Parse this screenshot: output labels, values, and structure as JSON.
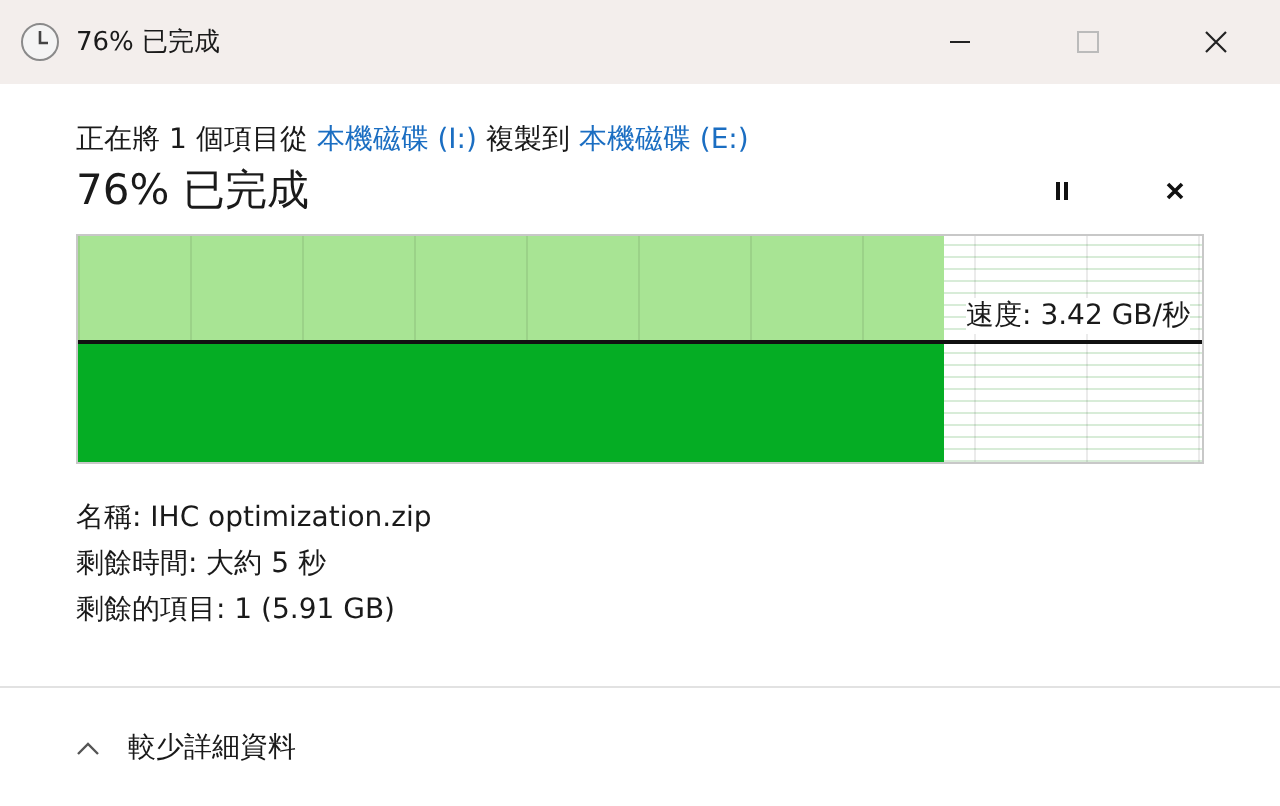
{
  "window": {
    "title": "76% 已完成"
  },
  "copy_line": [
    {
      "kind": "text",
      "text": "正在將 1 個項目從 "
    },
    {
      "kind": "link",
      "text": "本機磁碟 (I:)"
    },
    {
      "kind": "text",
      "text": " 複製到 "
    },
    {
      "kind": "link",
      "text": "本機磁碟 (E:)"
    }
  ],
  "heading": "76% 已完成",
  "progress": {
    "speed": "速度: 3.42 GB/秒"
  },
  "details": [
    "名稱: IHC optimization.zip",
    "剩餘時間: 大約 5 秒",
    "剩餘的項目: 1 (5.91 GB)"
  ],
  "footer": {
    "label": "較少詳細資料",
    "expanded": true
  }
}
